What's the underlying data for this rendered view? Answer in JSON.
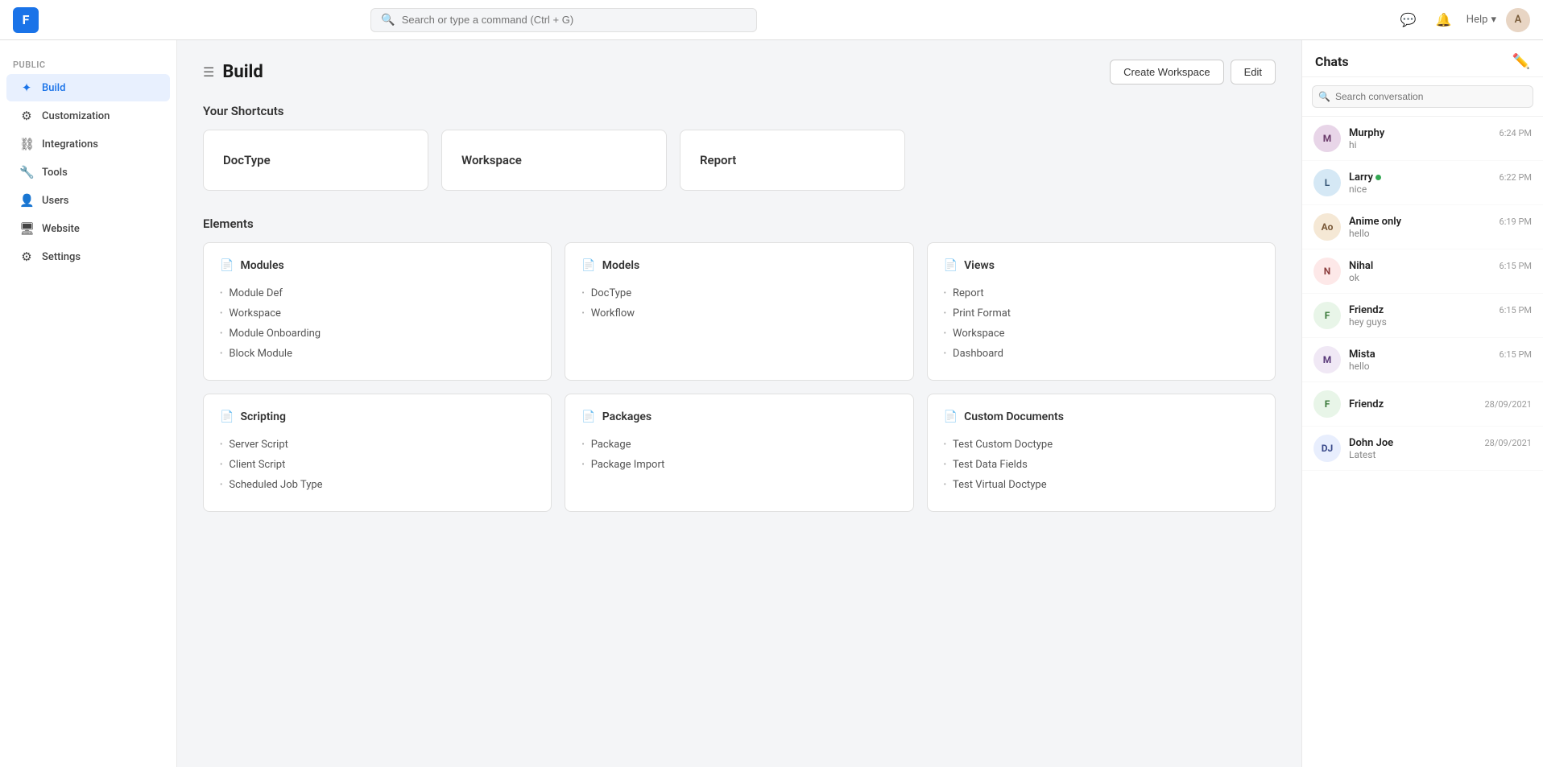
{
  "topnav": {
    "logo_letter": "F",
    "search_placeholder": "Search or type a command (Ctrl + G)",
    "help_label": "Help",
    "avatar_letter": "A"
  },
  "sidebar": {
    "section_label": "PUBLIC",
    "items": [
      {
        "id": "build",
        "label": "Build",
        "icon": "✦",
        "active": true
      },
      {
        "id": "customization",
        "label": "Customization",
        "icon": "⚙"
      },
      {
        "id": "integrations",
        "label": "Integrations",
        "icon": "⛓"
      },
      {
        "id": "tools",
        "label": "Tools",
        "icon": "🔧"
      },
      {
        "id": "users",
        "label": "Users",
        "icon": "👤"
      },
      {
        "id": "website",
        "label": "Website",
        "icon": "🖥"
      },
      {
        "id": "settings",
        "label": "Settings",
        "icon": "⚙"
      }
    ]
  },
  "page": {
    "title": "Build",
    "create_workspace_btn": "Create Workspace",
    "edit_btn": "Edit"
  },
  "shortcuts": {
    "section_title": "Your Shortcuts",
    "cards": [
      {
        "label": "DocType"
      },
      {
        "label": "Workspace"
      },
      {
        "label": "Report"
      }
    ]
  },
  "elements": {
    "section_title": "Elements",
    "cards": [
      {
        "id": "modules",
        "title": "Modules",
        "items": [
          "Module Def",
          "Workspace",
          "Module Onboarding",
          "Block Module"
        ]
      },
      {
        "id": "models",
        "title": "Models",
        "items": [
          "DocType",
          "Workflow"
        ]
      },
      {
        "id": "views",
        "title": "Views",
        "items": [
          "Report",
          "Print Format",
          "Workspace",
          "Dashboard"
        ]
      },
      {
        "id": "scripting",
        "title": "Scripting",
        "items": [
          "Server Script",
          "Client Script",
          "Scheduled Job Type"
        ]
      },
      {
        "id": "packages",
        "title": "Packages",
        "items": [
          "Package",
          "Package Import"
        ]
      },
      {
        "id": "custom-documents",
        "title": "Custom Documents",
        "items": [
          "Test Custom Doctype",
          "Test Data Fields",
          "Test Virtual Doctype"
        ]
      }
    ]
  },
  "chats": {
    "title": "Chats",
    "search_placeholder": "Search conversation",
    "items": [
      {
        "id": "murphy",
        "initials": "M",
        "name": "Murphy",
        "preview": "hi",
        "time": "6:24 PM",
        "online": false,
        "bg": "#e8d5e8",
        "color": "#6a3a6a"
      },
      {
        "id": "larry",
        "initials": "L",
        "name": "Larry",
        "preview": "nice",
        "time": "6:22 PM",
        "online": true,
        "bg": "#d5e8f5",
        "color": "#3a5a7a"
      },
      {
        "id": "anime-only",
        "initials": "Ao",
        "name": "Anime only",
        "preview": "hello",
        "time": "6:19 PM",
        "online": false,
        "bg": "#f5e8d5",
        "color": "#7a5a3a"
      },
      {
        "id": "nihal",
        "initials": "N",
        "name": "Nihal",
        "preview": "ok",
        "time": "6:15 PM",
        "online": false,
        "bg": "#fde8e8",
        "color": "#8a3a3a"
      },
      {
        "id": "friendz1",
        "initials": "F",
        "name": "Friendz",
        "preview": "hey guys",
        "time": "6:15 PM",
        "online": false,
        "bg": "#e8f5e8",
        "color": "#3a7a3a"
      },
      {
        "id": "mista",
        "initials": "M",
        "name": "Mista",
        "preview": "hello",
        "time": "6:15 PM",
        "online": false,
        "bg": "#f0e8f5",
        "color": "#5a3a7a"
      },
      {
        "id": "friendz2",
        "initials": "F",
        "name": "Friendz",
        "preview": "",
        "time": "28/09/2021",
        "online": false,
        "bg": "#e8f5e8",
        "color": "#3a7a3a"
      },
      {
        "id": "dohn-joe",
        "initials": "DJ",
        "name": "Dohn Joe",
        "preview": "Latest",
        "time": "28/09/2021",
        "online": false,
        "bg": "#e8eefd",
        "color": "#3a4a8a"
      }
    ]
  }
}
